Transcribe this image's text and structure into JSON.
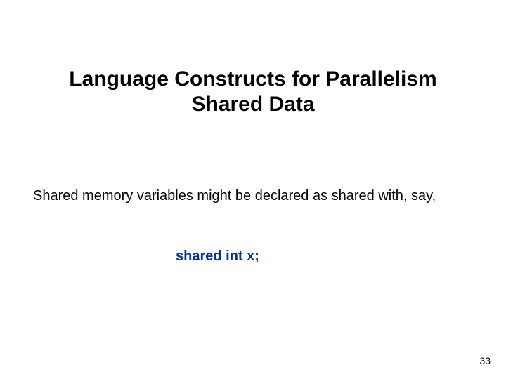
{
  "title_line1": "Language Constructs for Parallelism",
  "title_line2": "Shared Data",
  "body": "Shared memory variables might be declared as shared with, say,",
  "code": "shared int x;",
  "page_number": "33"
}
